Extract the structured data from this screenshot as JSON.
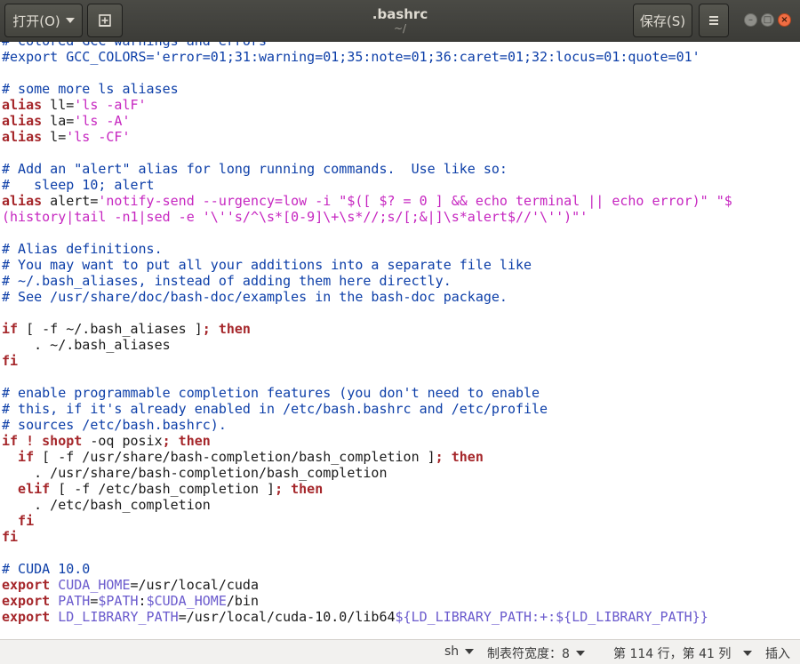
{
  "header": {
    "open_label": "打开(O)",
    "title": ".bashrc",
    "subtitle": "~/",
    "save_label": "保存(S)",
    "new_document_icon": "new-document-icon",
    "menu_icon": "hamburger-menu-icon"
  },
  "status": {
    "language": "sh",
    "tab_width": "制表符宽度：8",
    "position": "第 114 行，第 41 列",
    "mode": "插入"
  },
  "colors": {
    "comment": "#0c3ea8",
    "keyword": "#a5262a",
    "string": "#c626c0",
    "variable": "#6a5acd",
    "close_button": "#ef6d43"
  },
  "code": {
    "lines": [
      [
        {
          "t": "# colored GCC warnings and errors",
          "c": "comment"
        }
      ],
      [
        {
          "t": "#export GCC_COLORS='error=01;31:warning=01;35:note=01;36:caret=01;32:locus=01:quote=01'",
          "c": "comment"
        }
      ],
      [],
      [
        {
          "t": "# some more ls aliases",
          "c": "comment"
        }
      ],
      [
        {
          "t": "alias",
          "c": "keyword"
        },
        {
          "t": " ll=",
          "c": "default"
        },
        {
          "t": "'ls -alF'",
          "c": "string"
        }
      ],
      [
        {
          "t": "alias",
          "c": "keyword"
        },
        {
          "t": " la=",
          "c": "default"
        },
        {
          "t": "'ls -A'",
          "c": "string"
        }
      ],
      [
        {
          "t": "alias",
          "c": "keyword"
        },
        {
          "t": " l=",
          "c": "default"
        },
        {
          "t": "'ls -CF'",
          "c": "string"
        }
      ],
      [],
      [
        {
          "t": "# Add an \"alert\" alias for long running commands.  Use like so:",
          "c": "comment"
        }
      ],
      [
        {
          "t": "#   sleep 10; alert",
          "c": "comment"
        }
      ],
      [
        {
          "t": "alias",
          "c": "keyword"
        },
        {
          "t": " alert=",
          "c": "default"
        },
        {
          "t": "'notify-send --urgency=low -i \"$([ $? = 0 ] && echo terminal || echo error)\" \"$",
          "c": "string"
        }
      ],
      [
        {
          "t": "(history|tail -n1|sed -e '\\''s/^\\s*[0-9]\\+\\s*//;s/[;&|]\\s*alert$//'\\'')\"'",
          "c": "string"
        }
      ],
      [],
      [
        {
          "t": "# Alias definitions.",
          "c": "comment"
        }
      ],
      [
        {
          "t": "# You may want to put all your additions into a separate file like",
          "c": "comment"
        }
      ],
      [
        {
          "t": "# ~/.bash_aliases, instead of adding them here directly.",
          "c": "comment"
        }
      ],
      [
        {
          "t": "# See /usr/share/doc/bash-doc/examples in the bash-doc package.",
          "c": "comment"
        }
      ],
      [],
      [
        {
          "t": "if",
          "c": "keyword"
        },
        {
          "t": " [ -f ~/.bash_aliases ]",
          "c": "default"
        },
        {
          "t": "; then",
          "c": "keyword"
        }
      ],
      [
        {
          "t": "    . ~/.bash_aliases",
          "c": "default"
        }
      ],
      [
        {
          "t": "fi",
          "c": "keyword"
        }
      ],
      [],
      [
        {
          "t": "# enable programmable completion features (you don't need to enable",
          "c": "comment"
        }
      ],
      [
        {
          "t": "# this, if it's already enabled in /etc/bash.bashrc and /etc/profile",
          "c": "comment"
        }
      ],
      [
        {
          "t": "# sources /etc/bash.bashrc).",
          "c": "comment"
        }
      ],
      [
        {
          "t": "if ! shopt",
          "c": "keyword"
        },
        {
          "t": " -oq posix",
          "c": "default"
        },
        {
          "t": "; then",
          "c": "keyword"
        }
      ],
      [
        {
          "t": "  if",
          "c": "keyword"
        },
        {
          "t": " [ -f /usr/share/bash-completion/bash_completion ]",
          "c": "default"
        },
        {
          "t": "; then",
          "c": "keyword"
        }
      ],
      [
        {
          "t": "    . /usr/share/bash-completion/bash_completion",
          "c": "default"
        }
      ],
      [
        {
          "t": "  elif",
          "c": "keyword"
        },
        {
          "t": " [ -f /etc/bash_completion ]",
          "c": "default"
        },
        {
          "t": "; then",
          "c": "keyword"
        }
      ],
      [
        {
          "t": "    . /etc/bash_completion",
          "c": "default"
        }
      ],
      [
        {
          "t": "  fi",
          "c": "keyword"
        }
      ],
      [
        {
          "t": "fi",
          "c": "keyword"
        }
      ],
      [],
      [
        {
          "t": "# CUDA 10.0",
          "c": "comment"
        }
      ],
      [
        {
          "t": "export",
          "c": "keyword"
        },
        {
          "t": " CUDA_HOME",
          "c": "var"
        },
        {
          "t": "=/usr/local/cuda",
          "c": "default"
        }
      ],
      [
        {
          "t": "export",
          "c": "keyword"
        },
        {
          "t": " PATH",
          "c": "var"
        },
        {
          "t": "=",
          "c": "default"
        },
        {
          "t": "$PATH",
          "c": "var"
        },
        {
          "t": ":",
          "c": "default"
        },
        {
          "t": "$CUDA_HOME",
          "c": "var"
        },
        {
          "t": "/bin",
          "c": "default"
        }
      ],
      [
        {
          "t": "export",
          "c": "keyword"
        },
        {
          "t": " LD_LIBRARY_PATH",
          "c": "var"
        },
        {
          "t": "=/usr/local/cuda-10.0/lib64",
          "c": "default"
        },
        {
          "t": "${LD_LIBRARY_PATH:+:${LD_LIBRARY_PATH}}",
          "c": "var"
        }
      ]
    ]
  }
}
